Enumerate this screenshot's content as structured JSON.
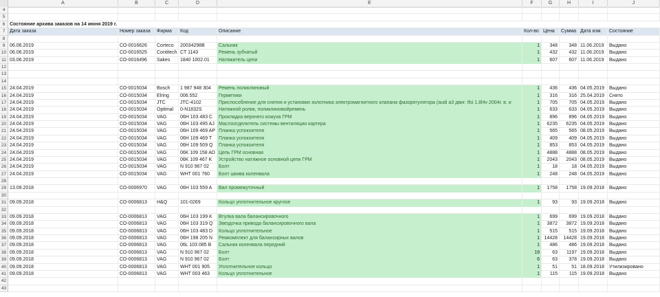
{
  "columns": [
    "A",
    "B",
    "C",
    "D",
    "E",
    "F",
    "G",
    "H",
    "I",
    "J"
  ],
  "sheet_title": "Состояние архива заказов на 14 июня 2019 г.",
  "header": [
    "Дата заказа",
    "Номер заказа",
    "Фирма",
    "Код",
    "Описание",
    "Кол-во",
    "Цена",
    "Сумма",
    "Дата изм.",
    "Состояние"
  ],
  "row_numbers": [
    "4",
    "5",
    "6",
    "7",
    "8",
    "9",
    "10",
    "11",
    "12",
    "13",
    "14",
    "15",
    "16",
    "17",
    "18",
    "19",
    "20",
    "21",
    "22",
    "23",
    "24",
    "25",
    "26",
    "27",
    "28",
    "29",
    "30",
    "31",
    "32",
    "33",
    "34",
    "35",
    "36",
    "37",
    "38",
    "39",
    "40",
    "41",
    "42",
    "43"
  ],
  "rows": [
    {
      "n": "4",
      "cells": null
    },
    {
      "n": "5",
      "cells": null
    },
    {
      "n": "6",
      "cells": "title"
    },
    {
      "n": "7",
      "cells": "header"
    },
    {
      "n": "8",
      "cells": null
    },
    {
      "n": "9",
      "cells": [
        "06.06.2019",
        "СО-0016626",
        "Corteco",
        "20034298B",
        "Сальник",
        "1",
        "348",
        "348",
        "11.06.2019",
        "Выдано"
      ]
    },
    {
      "n": "10",
      "cells": [
        "06.06.2019",
        "СО-0016525",
        "Contitech",
        "CT 1143",
        "Ремень зубчатый",
        "1",
        "432",
        "432",
        "11.06.2019",
        "Выдано"
      ]
    },
    {
      "n": "11",
      "cells": [
        "03.06.2019",
        "СО-0016496",
        "Sakes",
        "1840 1002.01",
        "Натяжитель цепи",
        "1",
        "607",
        "607",
        "11.06.2019",
        "Выдано"
      ]
    },
    {
      "n": "12",
      "cells": null
    },
    {
      "n": "13",
      "cells": null
    },
    {
      "n": "14",
      "cells": null
    },
    {
      "n": "15",
      "cells": [
        "24.04.2019",
        "СО-0015034",
        "Bosch",
        "1 987 948 304",
        "Ремень поликлиновый",
        "1",
        "436",
        "436",
        "04.05.2019",
        "Выдано"
      ]
    },
    {
      "n": "16",
      "cells": [
        "24.04.2019",
        "СО-0015034",
        "Elring",
        "006.552",
        "Герметики",
        "1",
        "316",
        "316",
        "25.04.2019",
        "Снято"
      ]
    },
    {
      "n": "17",
      "cells": [
        "24.04.2019",
        "СО-0015034",
        "JTC",
        "JTC-4102",
        "Приспособление для снятия и установки золотника электромагнитного клапана фазорегулятора (audi a3 двиг. tfsi 1.8l4v 2004г. в. и",
        "1",
        "705",
        "705",
        "04.05.2019",
        "Выдано"
      ]
    },
    {
      "n": "18",
      "cells": [
        "24.04.2019",
        "СО-0015034",
        "Optimal",
        "0-N1832S",
        "Натяжной ролик, поликлиновойремень",
        "1",
        "633",
        "633",
        "04.05.2019",
        "Выдано"
      ]
    },
    {
      "n": "19",
      "cells": [
        "24.04.2019",
        "СО-0015034",
        "VAG",
        "06H 103 483 C",
        "Прокладка верхнего кожуха ГРМ",
        "1",
        "896",
        "896",
        "04.05.2019",
        "Выдано"
      ]
    },
    {
      "n": "20",
      "cells": [
        "24.04.2019",
        "СО-0015034",
        "VAG",
        "06H 103 495 AJ",
        "Маслоотделитель системы вентиляции картера",
        "1",
        "6235",
        "6235",
        "04.05.2019",
        "Выдано"
      ]
    },
    {
      "n": "21",
      "cells": [
        "24.04.2019",
        "СО-0015034",
        "VAG",
        "06H 109 469 AP",
        "Планка успокоителя",
        "1",
        "565",
        "565",
        "08.05.2019",
        "Выдано"
      ]
    },
    {
      "n": "22",
      "cells": [
        "24.04.2019",
        "СО-0015034",
        "VAG",
        "06H 109 469 T",
        "Планка успокоителя",
        "1",
        "409",
        "409",
        "04.05.2019",
        "Выдано"
      ]
    },
    {
      "n": "23",
      "cells": [
        "24.04.2019",
        "СО-0015034",
        "VAG",
        "06H 109 509 Q",
        "Планка успокоителя",
        "1",
        "853",
        "853",
        "04.05.2019",
        "Выдано"
      ]
    },
    {
      "n": "24",
      "cells": [
        "24.04.2019",
        "СО-0015034",
        "VAG",
        "06K 109 158 AD",
        "Цепь ГРМ основная",
        "1",
        "4888",
        "4888",
        "08.05.2019",
        "Выдано"
      ]
    },
    {
      "n": "25",
      "cells": [
        "24.04.2019",
        "СО-0015034",
        "VAG",
        "06K 109 467 K",
        "Устройство натяжное основной цепи ГРМ",
        "1",
        "2043",
        "2043",
        "08.05.2019",
        "Выдано"
      ]
    },
    {
      "n": "26",
      "cells": [
        "24.04.2019",
        "СО-0015034",
        "VAG",
        "N 910 967 02",
        "Болт",
        "1",
        "18",
        "18",
        "04.05.2019",
        "Выдано"
      ]
    },
    {
      "n": "27",
      "cells": [
        "24.04.2019",
        "СО-0015034",
        "VAG",
        "WHT 001 760",
        "Болт шкива коленвала",
        "1",
        "248",
        "248",
        "04.05.2019",
        "Выдано"
      ]
    },
    {
      "n": "28",
      "cells": null
    },
    {
      "n": "29",
      "cells": [
        "13.09.2018",
        "СО-0006970",
        "VAG",
        "06H 103 559 A",
        "Вал промежуточный",
        "1",
        "1758",
        "1758",
        "19.09.2018",
        "Выдано"
      ]
    },
    {
      "n": "30",
      "cells": null
    },
    {
      "n": "31",
      "cells": [
        "09.09.2018",
        "СО-0006813",
        "H&Q",
        "101-0269",
        "Кольцо уплотнительное круглое",
        "1",
        "93",
        "93",
        "19.09.2018",
        "Выдано"
      ]
    },
    {
      "n": "32",
      "cells": null
    },
    {
      "n": "33",
      "cells": [
        "09.09.2018",
        "СО-0006813",
        "VAG",
        "06H 103 199 K",
        "Втулка вала балансировочного",
        "1",
        "699",
        "699",
        "19.09.2018",
        "Выдано"
      ]
    },
    {
      "n": "34",
      "cells": [
        "09.09.2018",
        "СО-0006813",
        "VAG",
        "06H 103 319 Q",
        "Звездочка привода балансировочного вала",
        "1",
        "3872",
        "3872",
        "19.09.2018",
        "Выдано"
      ]
    },
    {
      "n": "35",
      "cells": [
        "09.09.2018",
        "СО-0006813",
        "VAG",
        "06H 103 483 D",
        "Кольцо уплотнительное",
        "1",
        "515",
        "515",
        "19.09.2018",
        "Выдано"
      ]
    },
    {
      "n": "36",
      "cells": [
        "09.09.2018",
        "СО-0006813",
        "VAG",
        "06H 198 205 N",
        "Ремкомплект для балансирных валов",
        "1",
        "14428",
        "14428",
        "19.09.2018",
        "Выдано"
      ]
    },
    {
      "n": "37",
      "cells": [
        "09.09.2018",
        "СО-0006813",
        "VAG",
        "06L 103 085 B",
        "Сальник коленвала передний",
        "1",
        "486",
        "486",
        "19.09.2018",
        "Выдано"
      ]
    },
    {
      "n": "38",
      "cells": [
        "09.09.2018",
        "СО-0006813",
        "VAG",
        "N 910 967 02",
        "Болт",
        "19",
        "63",
        "1197",
        "19.09.2018",
        "Выдано"
      ]
    },
    {
      "n": "39",
      "cells": [
        "09.09.2018",
        "СО-0006813",
        "VAG",
        "N 910 967 02",
        "Болт",
        "6",
        "63",
        "378",
        "19.09.2018",
        "Выдано"
      ]
    },
    {
      "n": "40",
      "cells": [
        "09.09.2018",
        "СО-0006813",
        "VAG",
        "WHT 001 905",
        "Уплотнительное кольцо",
        "1",
        "51",
        "51",
        "18.09.2018",
        "Утилизировано"
      ]
    },
    {
      "n": "41",
      "cells": [
        "09.09.2018",
        "СО-0006813",
        "VAG",
        "WHT 003 463",
        "Кольцо уплотнительное",
        "1",
        "115",
        "115",
        "19.09.2018",
        "Выдано"
      ]
    },
    {
      "n": "42",
      "cells": null
    },
    {
      "n": "43",
      "cells": null
    }
  ],
  "colors": {
    "header_fill": "#dce6f1",
    "green_fill": "#c6efce",
    "green_text": "#2f6b2f"
  }
}
